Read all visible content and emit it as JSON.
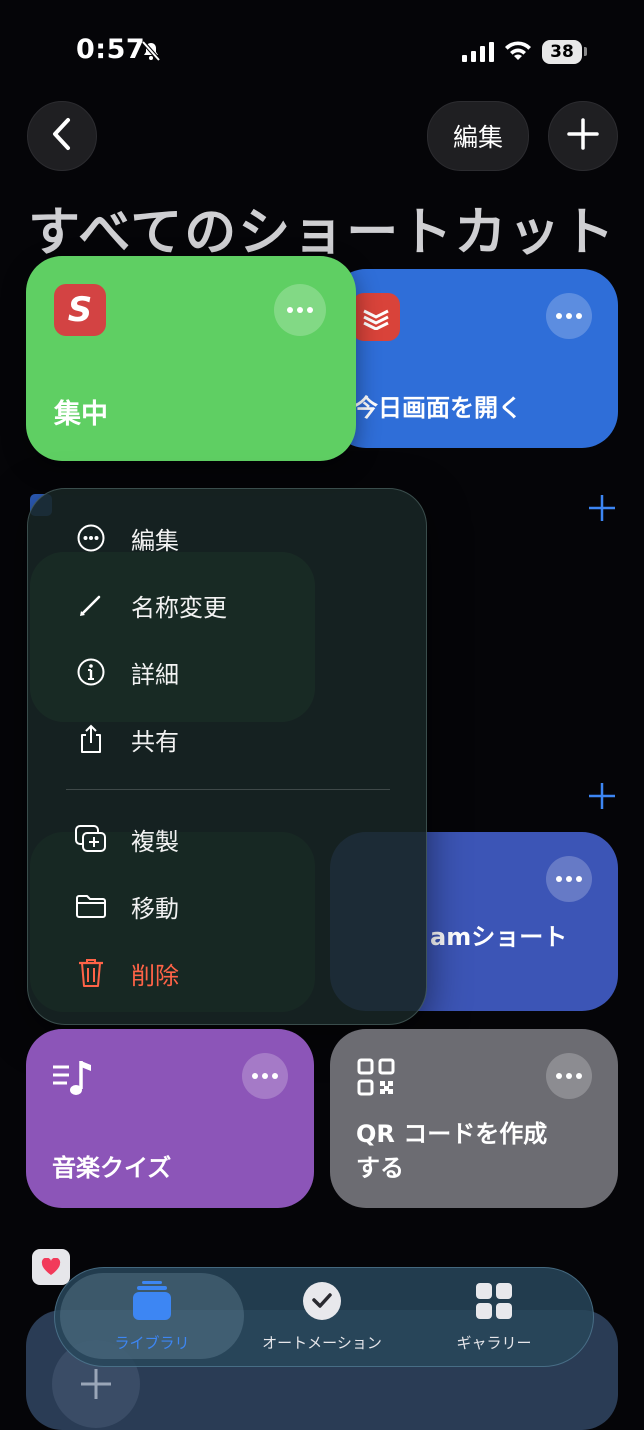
{
  "status_bar": {
    "time": "0:57",
    "battery": "38"
  },
  "nav": {
    "edit_label": "編集"
  },
  "page": {
    "title": "すべてのショートカット"
  },
  "cards": {
    "focus": {
      "title": "集中",
      "app_letter": "S",
      "color": "#5fcf63"
    },
    "today": {
      "title": "今日画面を開く",
      "color": "#2f6ed8"
    },
    "partial": {
      "title": "amショート",
      "color": "#3c55b6"
    },
    "music": {
      "title": "音楽クイズ",
      "color": "#8c55b8"
    },
    "qr": {
      "title_line1": "QR コードを作成",
      "title_line2": "する",
      "color": "#6c6c72"
    }
  },
  "context_menu": {
    "items": [
      {
        "label": "編集",
        "icon": "ellipsis-circle-icon"
      },
      {
        "label": "名称変更",
        "icon": "pencil-icon"
      },
      {
        "label": "詳細",
        "icon": "info-circle-icon"
      },
      {
        "label": "共有",
        "icon": "share-icon"
      },
      {
        "label": "複製",
        "icon": "duplicate-icon"
      },
      {
        "label": "移動",
        "icon": "folder-icon"
      },
      {
        "label": "削除",
        "icon": "trash-icon",
        "color": "#ff6347"
      }
    ]
  },
  "tab_bar": {
    "tabs": [
      {
        "label": "ライブラリ",
        "active": true
      },
      {
        "label": "オートメーション",
        "active": false
      },
      {
        "label": "ギャラリー",
        "active": false
      }
    ],
    "accent": "#3d86f3"
  }
}
